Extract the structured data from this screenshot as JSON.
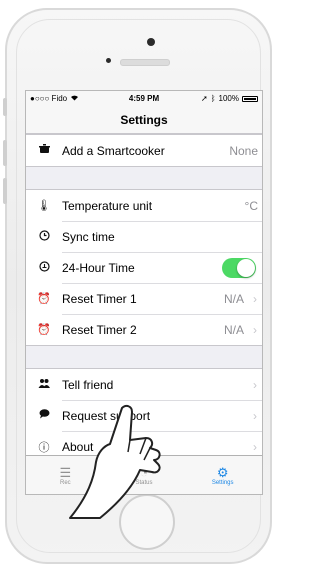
{
  "status_bar": {
    "carrier": "●○○○ Fido",
    "time": "4:59 PM",
    "battery": "100%"
  },
  "nav": {
    "title": "Settings"
  },
  "groups": [
    {
      "rows": [
        {
          "icon": "pot-icon",
          "label": "Add a Smartcooker",
          "value": "None"
        }
      ]
    },
    {
      "rows": [
        {
          "icon": "thermometer-icon",
          "label": "Temperature unit",
          "value": "°C"
        },
        {
          "icon": "clock-icon",
          "label": "Sync time",
          "value": ""
        },
        {
          "icon": "clock-24-icon",
          "label": "24-Hour Time",
          "toggle": true
        },
        {
          "icon": "alarm-icon",
          "label": "Reset Timer 1",
          "value": "N/A"
        },
        {
          "icon": "alarm-icon",
          "label": "Reset Timer 2",
          "value": "N/A"
        }
      ]
    },
    {
      "rows": [
        {
          "icon": "people-icon",
          "label": "Tell friend",
          "value": ""
        },
        {
          "icon": "speech-bubble-icon",
          "label": "Request support",
          "value": ""
        },
        {
          "icon": "info-icon",
          "label": "About",
          "value": ""
        }
      ]
    }
  ],
  "tabs": [
    {
      "icon": "list-icon",
      "label": "Rec"
    },
    {
      "icon": "status-icon",
      "label": "Status"
    },
    {
      "icon": "gear-icon",
      "label": "Settings",
      "active": true
    }
  ],
  "colors": {
    "toggle_on": "#4cd964",
    "tab_active": "#1e88e5"
  }
}
